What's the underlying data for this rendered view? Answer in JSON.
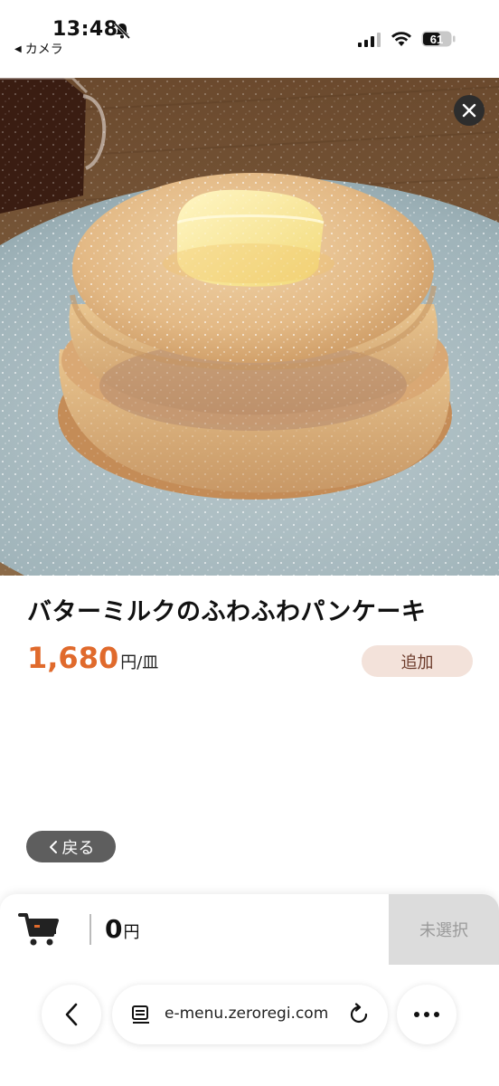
{
  "status_bar": {
    "time": "13:48",
    "back_app": "カメラ",
    "battery": "61",
    "icons": [
      "bell-slash-icon",
      "signal-icon",
      "wifi-icon",
      "battery-icon"
    ]
  },
  "photo": {
    "close_icon": "close-icon"
  },
  "product": {
    "name": "バターミルクのふわふわパンケーキ",
    "price": "1,680",
    "price_unit": "円/皿",
    "add_label": "追加"
  },
  "back_button": {
    "label": "戻る",
    "icon": "chevron-left-icon"
  },
  "cart": {
    "icon": "cart-icon",
    "amount": "0",
    "currency": "円",
    "action_label": "未選択"
  },
  "browser": {
    "url": "e-menu.zeroregi.com",
    "icons": [
      "chevron-left-icon",
      "reader-icon",
      "reload-icon",
      "more-icon"
    ]
  },
  "colors": {
    "price": "#e06a2c",
    "add_button_bg": "#f3e2da",
    "back_button_bg": "#5e5e5e",
    "unselected_bg": "#dcdcdc"
  }
}
